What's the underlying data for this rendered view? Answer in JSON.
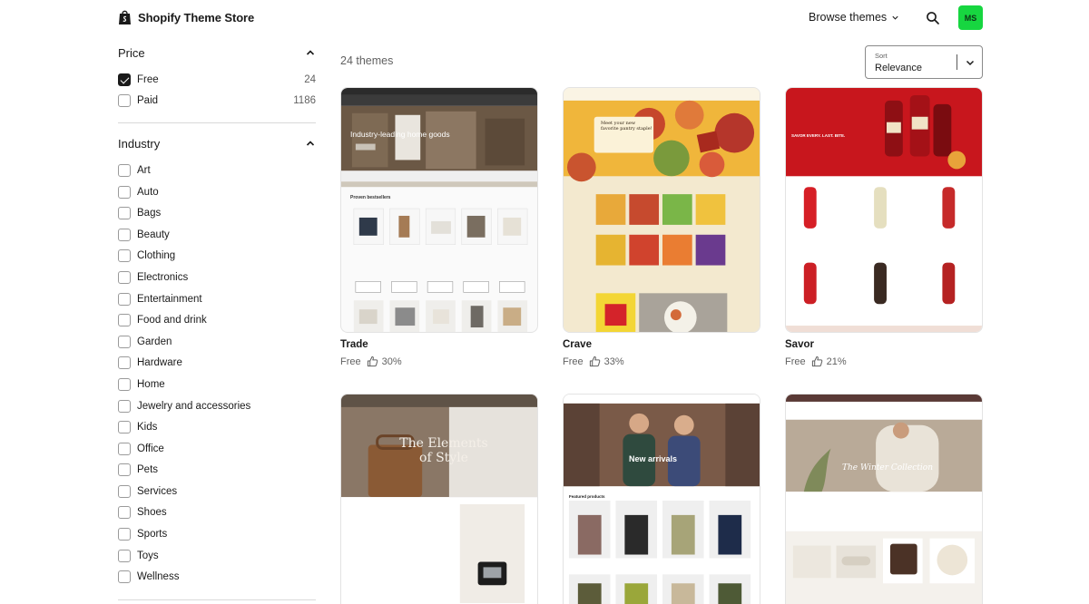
{
  "header": {
    "brand": "Shopify Theme Store",
    "browse_label": "Browse themes",
    "avatar_initials": "MS",
    "avatar_color": "#17d640"
  },
  "filters": {
    "price": {
      "title": "Price",
      "options": [
        {
          "label": "Free",
          "count": "24",
          "checked": true
        },
        {
          "label": "Paid",
          "count": "1186",
          "checked": false
        }
      ]
    },
    "industry": {
      "title": "Industry",
      "options": [
        "Art",
        "Auto",
        "Bags",
        "Beauty",
        "Clothing",
        "Electronics",
        "Entertainment",
        "Food and drink",
        "Garden",
        "Hardware",
        "Home",
        "Jewelry and accessories",
        "Kids",
        "Office",
        "Pets",
        "Services",
        "Shoes",
        "Sports",
        "Toys",
        "Wellness"
      ]
    }
  },
  "results": {
    "count_label": "24 themes",
    "sort": {
      "label": "Sort",
      "value": "Relevance"
    }
  },
  "themes": [
    {
      "name": "Trade",
      "price": "Free",
      "rating": "30%",
      "preview_headline": "Industry-leading home goods",
      "preview_section": "Proven bestsellers"
    },
    {
      "name": "Crave",
      "price": "Free",
      "rating": "33%",
      "preview_headline": "Meet your new favorite pantry staple!"
    },
    {
      "name": "Savor",
      "price": "Free",
      "rating": "21%",
      "preview_headline": "SAVOR EVERY. LAST. BITE."
    },
    {
      "name": "",
      "price": "",
      "rating": "",
      "preview_headline": "The Elements of Style"
    },
    {
      "name": "",
      "price": "",
      "rating": "",
      "preview_headline": "New arrivals",
      "preview_section": "Featured products"
    },
    {
      "name": "",
      "price": "",
      "rating": "",
      "preview_headline": "The Winter Collection"
    }
  ]
}
